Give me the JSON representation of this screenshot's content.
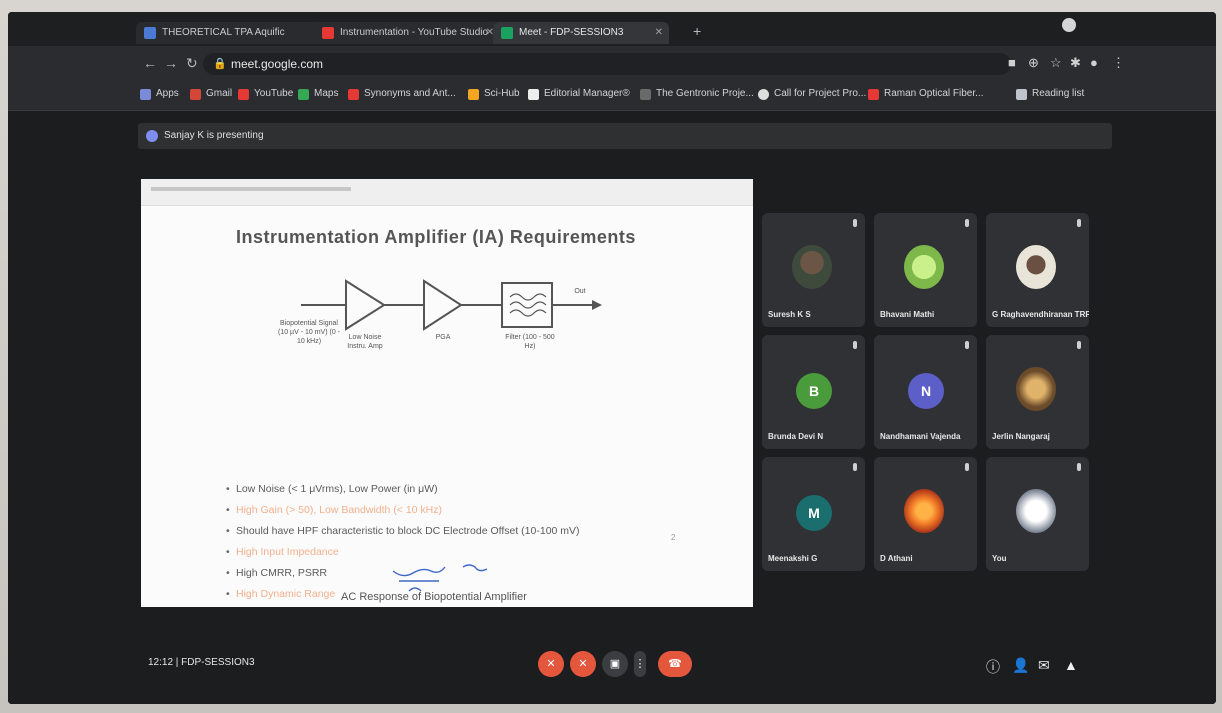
{
  "browser": {
    "tabs": [
      {
        "label": "THEORETICAL TPA Aquific"
      },
      {
        "label": "Instrumentation - YouTube Studio"
      },
      {
        "label": "Meet - FDP-SESSION3"
      }
    ],
    "new_tab_label": "+",
    "address": "meet.google.com",
    "bookmarks": [
      {
        "label": "Apps"
      },
      {
        "label": "Gmail"
      },
      {
        "label": "YouTube"
      },
      {
        "label": "Maps"
      },
      {
        "label": "Synonyms and Ant..."
      },
      {
        "label": "Sci-Hub"
      },
      {
        "label": "Editorial Manager®"
      },
      {
        "label": "The Gentronic Proje..."
      },
      {
        "label": "Call for Project Pro..."
      },
      {
        "label": "Raman Optical Fiber..."
      },
      {
        "label": "Reading list"
      }
    ]
  },
  "meet": {
    "presenting_label": "Sanjay K is presenting",
    "slide": {
      "title": "Instrumentation Amplifier (IA) Requirements",
      "diagram_labels": {
        "input": "Biopotential Signal (10 µV - 10 mV) (0 - 10 kHz)",
        "stage1": "Low Noise Instru. Amp",
        "stage2": "PGA",
        "filter": "Filter (100 - 500 Hz)",
        "output": "Out"
      },
      "bullets": [
        {
          "text": "Low Noise (< 1 μVrms), Low Power (in μW)",
          "style": "dark"
        },
        {
          "text": "High Gain (> 50), Low Bandwidth (< 10 kHz)",
          "style": "orange"
        },
        {
          "text": "Should have HPF characteristic to block DC Electrode Offset (10-100 mV)",
          "style": "dark"
        },
        {
          "text": "High Input Impedance",
          "style": "orange"
        },
        {
          "text": "High CMRR, PSRR",
          "style": "dark"
        },
        {
          "text": "High Dynamic Range",
          "style": "orange"
        }
      ],
      "page_number": "2",
      "next_slide_title": "AC Response of Biopotential Amplifier"
    },
    "participants": [
      {
        "name": "Suresh K S",
        "avatar": "photo",
        "color": "#3e4a3c"
      },
      {
        "name": "Bhavani Mathi",
        "avatar": "photo",
        "color": "#a6d36a"
      },
      {
        "name": "G Raghavendhiranan TRP",
        "avatar": "photo",
        "color": "#d8d2c4"
      },
      {
        "name": "Brunda Devi N",
        "avatar": "B",
        "color": "#4a9b3b"
      },
      {
        "name": "Nandhamani Vajenda",
        "avatar": "N",
        "color": "#5b5fc7"
      },
      {
        "name": "Jerlin Nangaraj",
        "avatar": "photo",
        "color": "#c89a4b"
      },
      {
        "name": "Meenakshi G",
        "avatar": "M",
        "color": "#1b6e6e"
      },
      {
        "name": "D Athani",
        "avatar": "photo",
        "color": "#f07a28"
      },
      {
        "name": "You",
        "avatar": "photo",
        "color": "#e8e8e8"
      }
    ],
    "meeting_info": "12:12 | FDP-SESSION3",
    "controls": [
      "mic-off",
      "camera-off",
      "present",
      "more",
      "end-call"
    ]
  },
  "colors": {
    "accent_red": "#e4573c",
    "bullet_orange": "#f1b08c",
    "tile_bg": "#2f3134"
  }
}
